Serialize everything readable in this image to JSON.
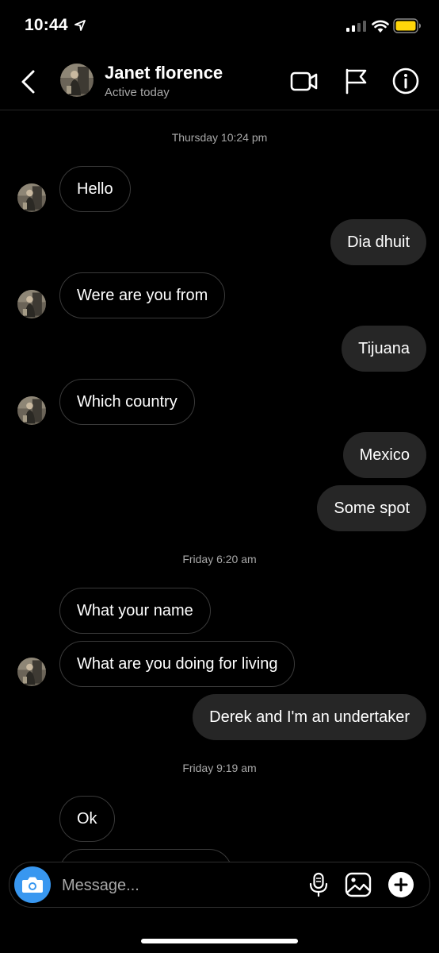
{
  "status_bar": {
    "time": "10:44"
  },
  "header": {
    "name": "Janet florence",
    "status": "Active today"
  },
  "chat": {
    "timestamps": [
      "Thursday 10:24 pm",
      "Friday 6:20 am",
      "Friday 9:19 am"
    ],
    "messages": [
      {
        "from": "them",
        "text": "Hello"
      },
      {
        "from": "me",
        "text": "Dia dhuit"
      },
      {
        "from": "them",
        "text": "Were are you from"
      },
      {
        "from": "me",
        "text": "Tijuana"
      },
      {
        "from": "them",
        "text": "Which country"
      },
      {
        "from": "me",
        "text": "Mexico"
      },
      {
        "from": "me",
        "text": "Some spot"
      },
      {
        "from": "them",
        "text": "What your name"
      },
      {
        "from": "them",
        "text": "What are you doing for living"
      },
      {
        "from": "me",
        "text": "Derek and I'm an undertaker"
      },
      {
        "from": "them",
        "text": "Ok"
      }
    ]
  },
  "composer": {
    "placeholder": "Message..."
  },
  "colors": {
    "background": "#000000",
    "incoming_border": "#3a3a3a",
    "outgoing_bubble": "#262626",
    "camera_button": "#3897f0",
    "battery": "#ffd60a"
  },
  "icons": [
    "location-arrow-icon",
    "signal-icon",
    "wifi-icon",
    "battery-icon",
    "back-icon",
    "video-call-icon",
    "flag-icon",
    "info-icon",
    "camera-icon",
    "microphone-icon",
    "gallery-icon",
    "plus-icon"
  ]
}
